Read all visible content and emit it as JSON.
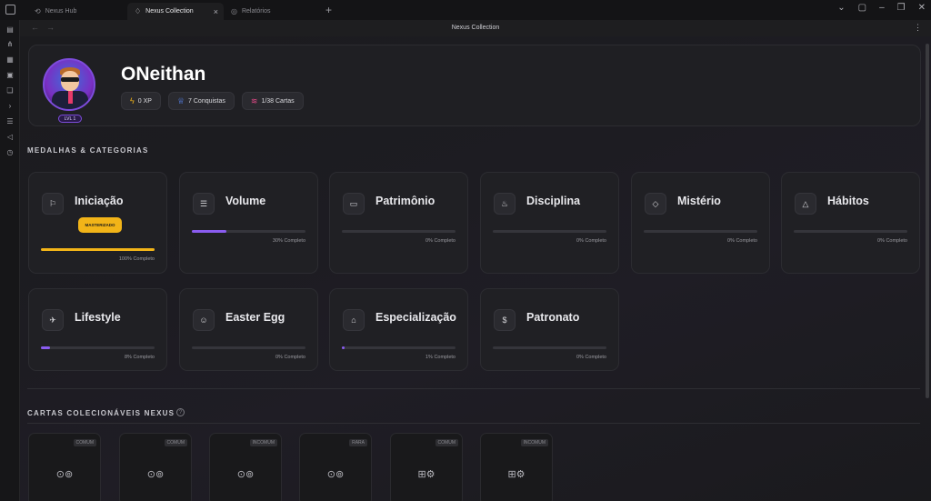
{
  "tabs": [
    {
      "label": "Nexus Hub",
      "icon": "hub-icon"
    },
    {
      "label": "Nexus Collection",
      "icon": "gem-icon"
    },
    {
      "label": "Relatórios",
      "icon": "globe-icon"
    }
  ],
  "header": {
    "title": "Nexus Collection"
  },
  "profile": {
    "username": "ONeithan",
    "level": "LVL 1",
    "stats": [
      {
        "label": "0 XP",
        "icon": "bolt-icon",
        "color": "#f2b418"
      },
      {
        "label": "7 Conquistas",
        "icon": "trophy-icon",
        "color": "#5b8cff"
      },
      {
        "label": "1/38 Cartas",
        "icon": "layers-icon",
        "color": "#e84a8a"
      }
    ]
  },
  "medals_section": {
    "title": "MEDALHAS & CATEGORIAS"
  },
  "categories": [
    {
      "name": "Iniciação",
      "icon": "flag-icon",
      "progress": 100,
      "pct_label": "100% Completo",
      "badge": "MASTERIZADO",
      "bar_color": "#f2b418"
    },
    {
      "name": "Volume",
      "icon": "list-icon",
      "progress": 30,
      "pct_label": "30% Completo"
    },
    {
      "name": "Patrimônio",
      "icon": "briefcase-icon",
      "progress": 0,
      "pct_label": "0% Completo"
    },
    {
      "name": "Disciplina",
      "icon": "flame-icon",
      "progress": 0,
      "pct_label": "0% Completo"
    },
    {
      "name": "Mistério",
      "icon": "tag-icon",
      "progress": 0,
      "pct_label": "0% Completo"
    },
    {
      "name": "Hábitos",
      "icon": "warning-icon",
      "progress": 0,
      "pct_label": "0% Completo"
    },
    {
      "name": "Lifestyle",
      "icon": "plane-icon",
      "progress": 8,
      "pct_label": "8% Completo"
    },
    {
      "name": "Easter Egg",
      "icon": "smile-icon",
      "progress": 0,
      "pct_label": "0% Completo"
    },
    {
      "name": "Especialização",
      "icon": "home-icon",
      "progress": 1,
      "pct_label": "1% Completo"
    },
    {
      "name": "Patronato",
      "icon": "dollar-icon",
      "progress": 0,
      "pct_label": "0% Completo"
    }
  ],
  "cards_section": {
    "title": "CARTAS COLECIONÁVEIS NEXUS"
  },
  "nexus_cards": [
    {
      "rarity": "COMUM",
      "icon": "coins-icon"
    },
    {
      "rarity": "COMUM",
      "icon": "coins-icon"
    },
    {
      "rarity": "INCOMUM",
      "icon": "coins-icon"
    },
    {
      "rarity": "RARA",
      "icon": "coins-icon"
    },
    {
      "rarity": "COMUM",
      "icon": "chip-icon"
    },
    {
      "rarity": "INCOMUM",
      "icon": "chip-icon"
    }
  ]
}
